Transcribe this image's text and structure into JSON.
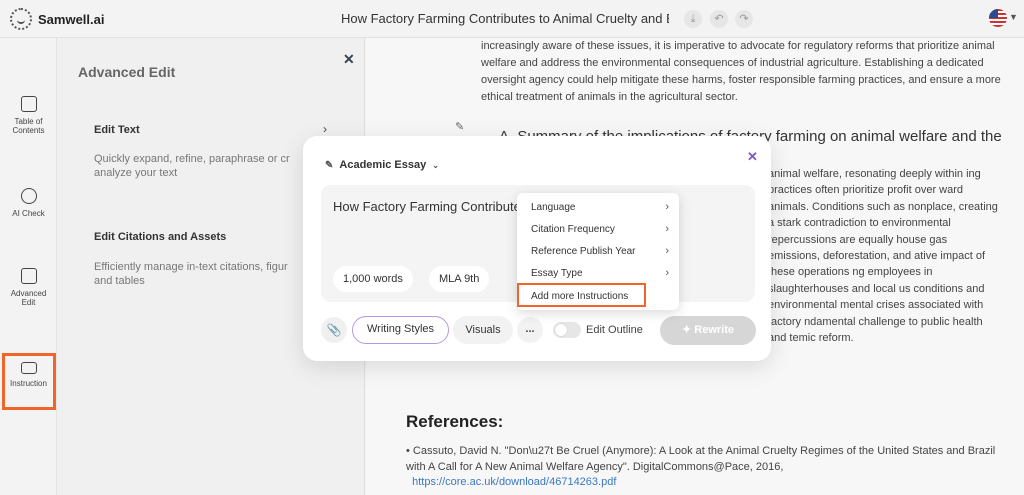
{
  "app": {
    "name": "Samwell.ai"
  },
  "topbar": {
    "doc_title": "How Factory Farming Contributes to Animal Cruelty and En...",
    "icons": [
      "download-icon",
      "undo-icon",
      "redo-icon"
    ],
    "language_flag": "us-flag-icon"
  },
  "rail": {
    "items": [
      {
        "label": "Table of Contents",
        "icon": "book-icon"
      },
      {
        "label": "AI Check",
        "icon": "ai-check-icon"
      },
      {
        "label": "Advanced Edit",
        "icon": "edit-icon"
      },
      {
        "label": "Instruction",
        "icon": "instruction-icon"
      }
    ]
  },
  "panel": {
    "title": "Advanced Edit",
    "edit_text": {
      "title": "Edit Text",
      "desc": "Quickly expand, refine, paraphrase or cr analyze your text"
    },
    "edit_citations": {
      "title": "Edit Citations and Assets",
      "desc": "Efficiently manage in-text citations, figur and tables"
    }
  },
  "document": {
    "para1": "increasingly aware of these issues, it is imperative to advocate for regulatory reforms that prioritize animal welfare and address the environmental consequences of industrial agriculture. Establishing a dedicated oversight agency could help mitigate these harms, foster responsible farming practices, and ensure a more ethical treatment of animals in the agricultural sector.",
    "heading": "A. Summary of the implications of factory farming on animal welfare and the",
    "right_text": "animal welfare, resonating deeply within ing practices often prioritize profit over ward animals. Conditions such as nonplace, creating a stark contradiction to environmental repercussions are equally house gas emissions, deforestation, and ative impact of these operations ng employees in slaughterhouses and local us conditions and environmental mental crises associated with factory ndamental challenge to public health and temic reform.",
    "references_title": "References:",
    "reference_1": "Cassuto, David N. \"Don\\u27t Be Cruel (Anymore): A Look at the Animal Cruelty Regimes of the United States and Brazil with A Call for A New Animal Welfare Agency\". DigitalCommons@Pace, 2016,",
    "reference_1_link": "https://core.ac.uk/download/46714263.pdf"
  },
  "modal": {
    "essay_type": "Academic Essay",
    "prompt": "How Factory Farming Contribute                          ironmental Harm",
    "word_count": "1,000 words",
    "citation_style": "MLA 9th",
    "writing_styles": "Writing Styles",
    "visuals": "Visuals",
    "more": "...",
    "edit_outline": "Edit Outline",
    "rewrite": "Rewrite"
  },
  "dropdown": {
    "items": [
      {
        "label": "Language",
        "has_submenu": true
      },
      {
        "label": "Citation Frequency",
        "has_submenu": true
      },
      {
        "label": "Reference Publish Year",
        "has_submenu": true
      },
      {
        "label": "Essay Type",
        "has_submenu": true
      },
      {
        "label": "Add more Instructions",
        "has_submenu": false
      }
    ]
  },
  "colors": {
    "accent": "#7e57c2",
    "highlight": "#f0652a",
    "link": "#3a78c3"
  }
}
